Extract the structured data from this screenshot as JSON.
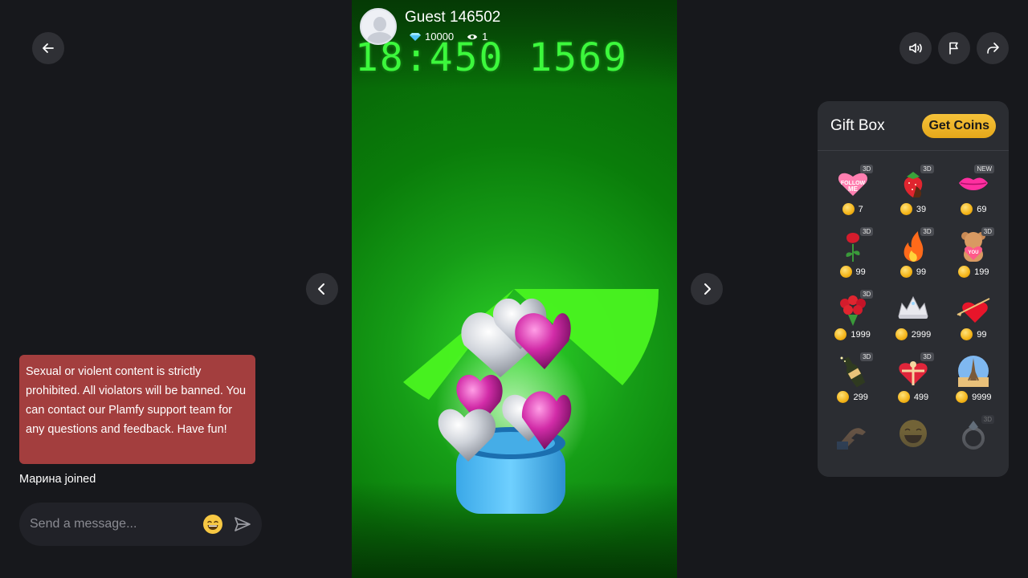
{
  "streamer": {
    "name": "Guest 146502",
    "diamonds": "10000",
    "viewers": "1"
  },
  "video": {
    "timecode": "18:450 1569"
  },
  "chat": {
    "notice": "Sexual or violent content is strictly prohibited. All violators will be banned. You can contact our Plamfy support team for any questions and feedback. Have fun!",
    "joined": "Марина joined",
    "placeholder": "Send a message..."
  },
  "gift_box": {
    "title": "Gift Box",
    "get_coins": "Get Coins",
    "gifts": [
      {
        "name": "follow-me-heart",
        "price": "7",
        "badge": "3D"
      },
      {
        "name": "strawberry",
        "price": "39",
        "badge": "3D"
      },
      {
        "name": "lips",
        "price": "69",
        "badge": "NEW"
      },
      {
        "name": "rose",
        "price": "99",
        "badge": "3D"
      },
      {
        "name": "fire",
        "price": "99",
        "badge": "3D"
      },
      {
        "name": "teddy-bear",
        "price": "199",
        "badge": "3D"
      },
      {
        "name": "rose-bouquet",
        "price": "1999",
        "badge": "3D"
      },
      {
        "name": "tiara",
        "price": "2999",
        "badge": ""
      },
      {
        "name": "arrow-heart",
        "price": "99",
        "badge": ""
      },
      {
        "name": "champagne",
        "price": "299",
        "badge": "3D"
      },
      {
        "name": "heart-gift-box",
        "price": "499",
        "badge": "3D"
      },
      {
        "name": "eiffel-globe",
        "price": "9999",
        "badge": ""
      },
      {
        "name": "hand",
        "price": "",
        "badge": ""
      },
      {
        "name": "laughing-face",
        "price": "",
        "badge": ""
      },
      {
        "name": "ring",
        "price": "",
        "badge": "3D"
      }
    ]
  },
  "colors": {
    "background": "#17181c",
    "notice": "#a33e3e",
    "panel": "#2b2d32",
    "coins_button": "#f0b72a",
    "timecode": "#3cf83c"
  }
}
